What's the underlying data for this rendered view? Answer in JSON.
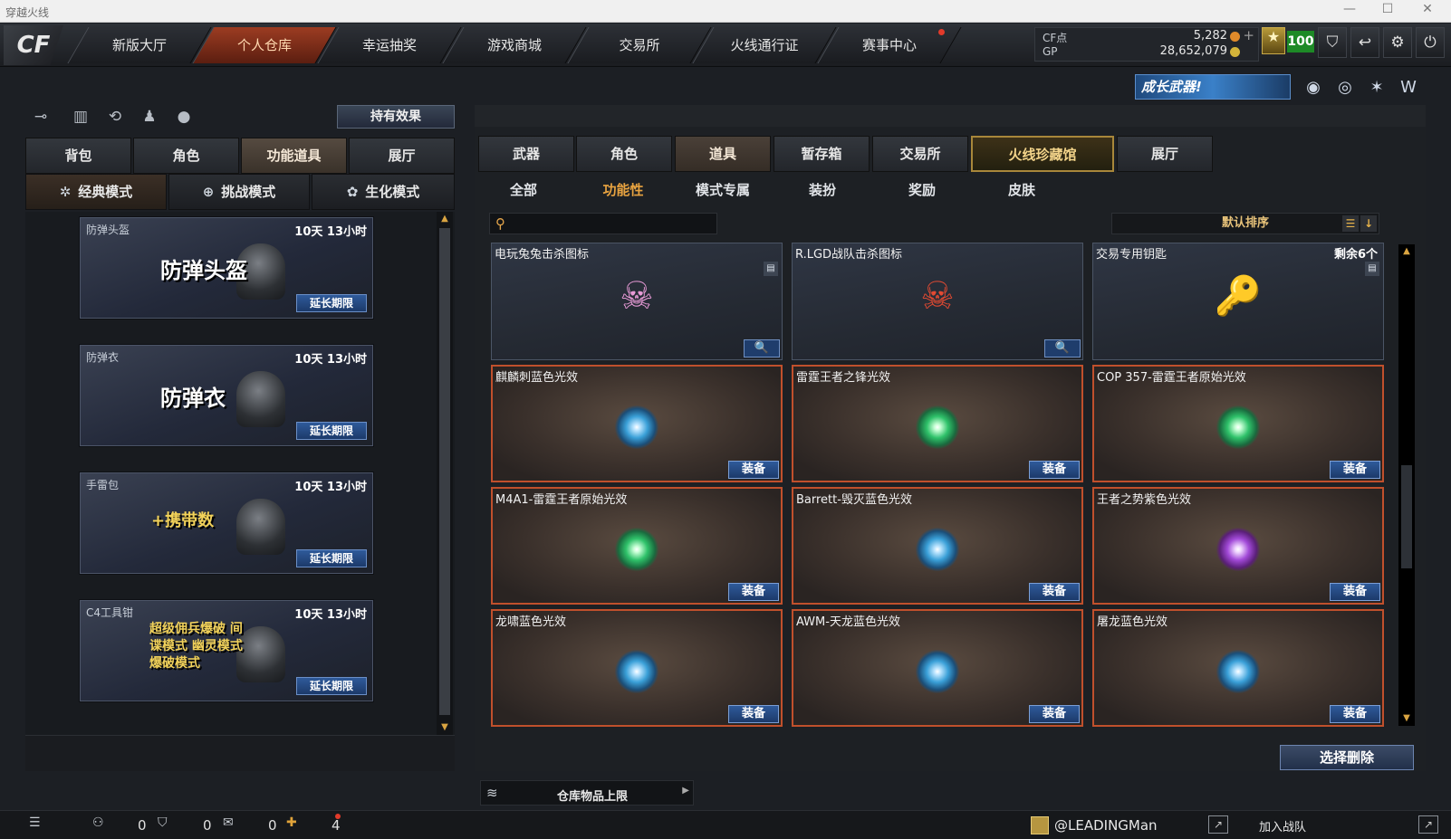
{
  "window": {
    "title": "穿越火线",
    "minimize": "—",
    "maximize": "☐",
    "close": "✕"
  },
  "logo": "CF",
  "nav": [
    "新版大厅",
    "个人仓库",
    "幸运抽奖",
    "游戏商城",
    "交易所",
    "火线通行证",
    "赛事中心"
  ],
  "nav_active": 1,
  "currency": {
    "cf_label": "CF点",
    "cf_value": "5,282",
    "gp_label": "GP",
    "gp_value": "28,652,079",
    "plus": "+"
  },
  "level": "100",
  "banner_text": "成长武器!",
  "left": {
    "hold_effect": "持有效果",
    "tabs": [
      "背包",
      "角色",
      "功能道具",
      "展厅"
    ],
    "tab_active": 2,
    "modes": [
      "经典模式",
      "挑战模式",
      "生化模式"
    ],
    "mode_active": 0,
    "items": [
      {
        "name": "防弹头盔",
        "time": "10天 13小时",
        "big": "防弹头盔",
        "action": "延长期限"
      },
      {
        "name": "防弹衣",
        "time": "10天 13小时",
        "big": "防弹衣",
        "action": "延长期限"
      },
      {
        "name": "手雷包",
        "time": "10天 13小时",
        "big": "+携带数",
        "action": "延长期限"
      },
      {
        "name": "C4工具钳",
        "time": "10天 13小时",
        "big": "超级佣兵爆破 间谍模式 幽灵模式 爆破模式",
        "action": "延长期限"
      }
    ]
  },
  "right": {
    "tabs": [
      "武器",
      "角色",
      "道具",
      "暂存箱",
      "交易所",
      "火线珍藏馆",
      "展厅"
    ],
    "tab_active": 2,
    "subtabs": [
      "全部",
      "功能性",
      "模式专属",
      "装扮",
      "奖励",
      "皮肤"
    ],
    "subtab_active": 1,
    "search_placeholder": "",
    "sort_label": "默认排序",
    "cards": [
      {
        "name": "电玩兔兔击杀图标",
        "kind": "icon",
        "emblem": "☠",
        "extra": "",
        "action": "🔍"
      },
      {
        "name": "R.LGD战队击杀图标",
        "kind": "icon",
        "emblem": "☠",
        "extra": "",
        "action": "🔍"
      },
      {
        "name": "交易专用钥匙",
        "kind": "key",
        "emblem": "🔑",
        "extra": "剩余6个",
        "action": ""
      },
      {
        "name": "麒麟刺蓝色光效",
        "kind": "glow",
        "color": "blue",
        "action": "装备"
      },
      {
        "name": "雷霆王者之锋光效",
        "kind": "glow",
        "color": "green",
        "action": "装备"
      },
      {
        "name": "COP 357-雷霆王者原始光效",
        "kind": "glow",
        "color": "green",
        "action": "装备"
      },
      {
        "name": "M4A1-雷霆王者原始光效",
        "kind": "glow",
        "color": "green",
        "action": "装备"
      },
      {
        "name": "Barrett-毁灭蓝色光效",
        "kind": "glow",
        "color": "blue",
        "action": "装备"
      },
      {
        "name": "王者之势紫色光效",
        "kind": "glow",
        "color": "purple",
        "action": "装备"
      },
      {
        "name": "龙啸蓝色光效",
        "kind": "glow",
        "color": "blue",
        "action": "装备"
      },
      {
        "name": "AWM-天龙蓝色光效",
        "kind": "glow",
        "color": "blue",
        "action": "装备"
      },
      {
        "name": "屠龙蓝色光效",
        "kind": "glow",
        "color": "blue",
        "action": "装备"
      }
    ],
    "delete_btn": "选择删除",
    "capacity_label": "仓库物品上限"
  },
  "status": {
    "counts": [
      "0",
      "0",
      "0",
      "4"
    ],
    "user": "@LEADINGMan",
    "join": "加入战队"
  }
}
